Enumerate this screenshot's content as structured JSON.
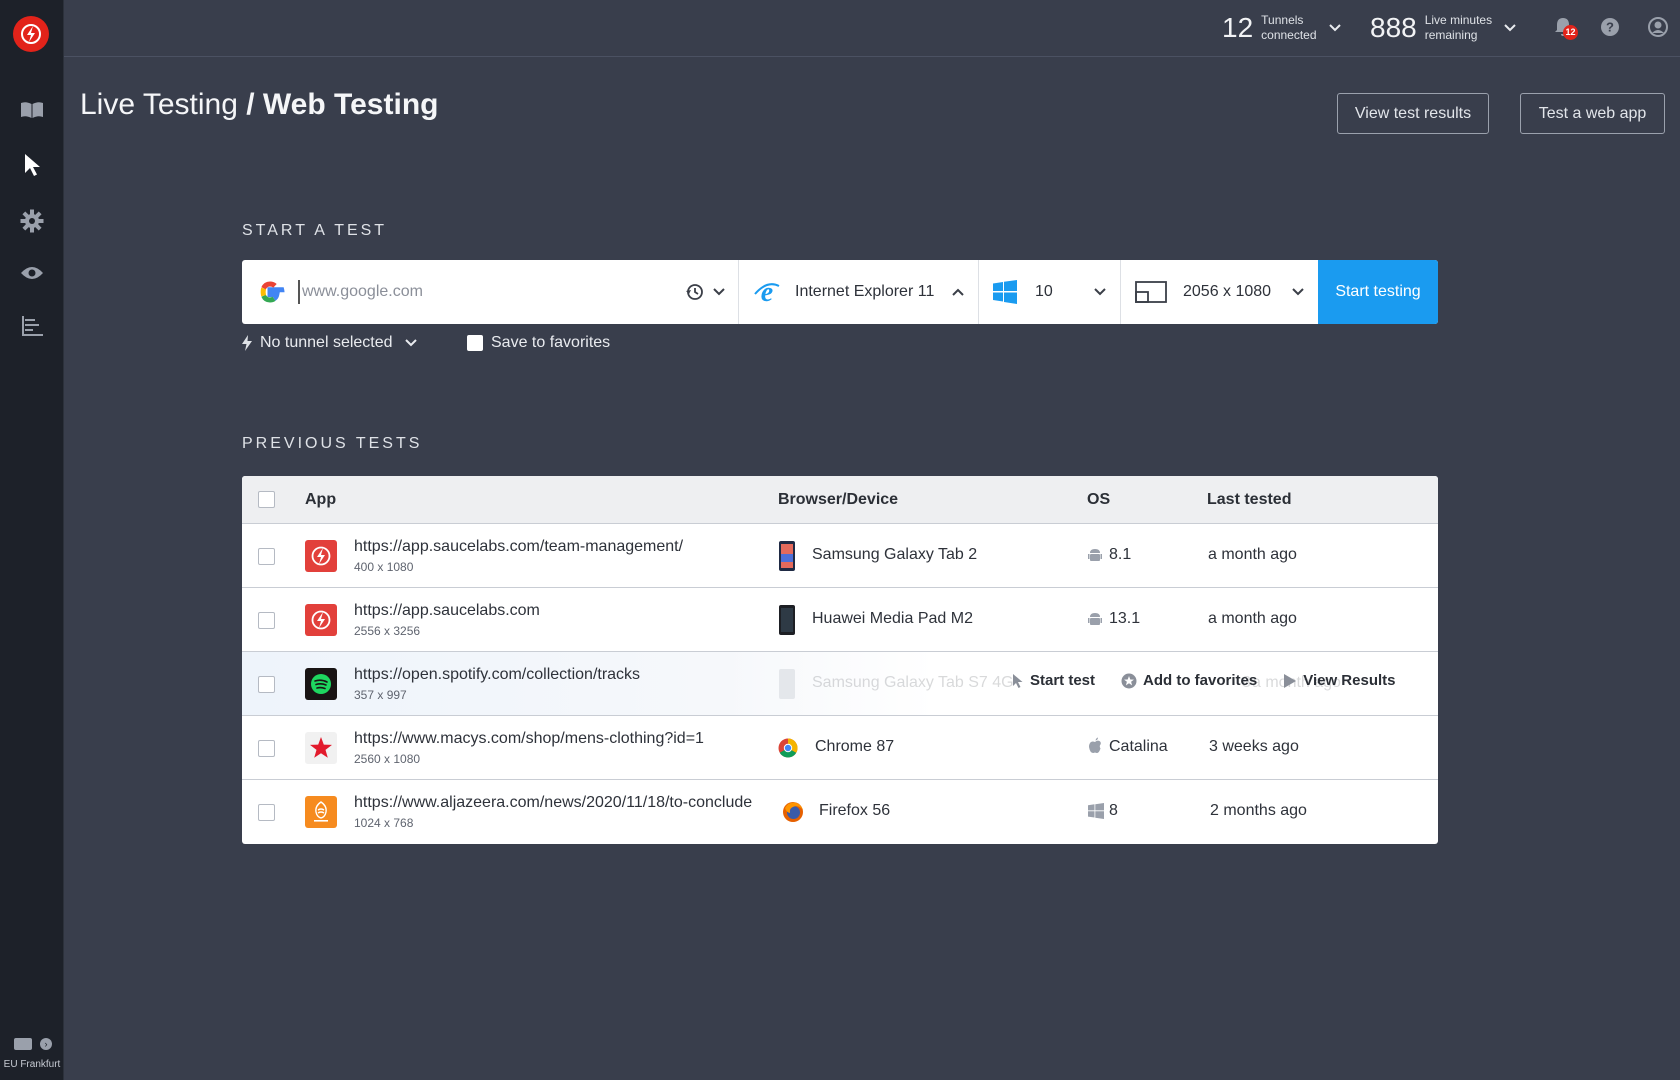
{
  "topbar": {
    "tunnels_count": "12",
    "tunnels_label_1": "Tunnels",
    "tunnels_label_2": "connected",
    "minutes_count": "888",
    "minutes_label_1": "Live minutes",
    "minutes_label_2": "remaining",
    "notifications_count": "12"
  },
  "sidebar": {
    "region": "EU Frankfurt",
    "items": [
      "book-icon",
      "cursor-icon",
      "gear-icon",
      "eye-icon",
      "bar-chart-icon"
    ]
  },
  "header": {
    "breadcrumb_parent": "Live Testing",
    "breadcrumb_sep": " / ",
    "breadcrumb_current": "Web Testing",
    "view_results_label": "View test results",
    "test_web_app_label": "Test a web app"
  },
  "start": {
    "section_label": "START A TEST",
    "url_placeholder": "www.google.com",
    "browser": "Internet Explorer 11",
    "os_version": "10",
    "resolution": "2056 x 1080",
    "start_label": "Start testing",
    "tunnel_label": "No tunnel selected",
    "save_favorites_label": "Save to favorites"
  },
  "previous": {
    "section_label": "PREVIOUS TESTS",
    "columns": {
      "app": "App",
      "browser": "Browser/Device",
      "os": "OS",
      "last": "Last tested"
    },
    "rows": [
      {
        "url": "https://app.saucelabs.com/team-management/",
        "res": "400 x 1080",
        "device": "Samsung Galaxy Tab 2",
        "os": "8.1",
        "last": "a month ago"
      },
      {
        "url": "https://app.saucelabs.com",
        "res": "2556 x 3256",
        "device": "Huawei Media Pad M2",
        "os": "13.1",
        "last": "a month ago"
      },
      {
        "url": "https://open.spotify.com/collection/tracks",
        "res": "357 x 997",
        "device": "Samsung Galaxy Tab S7 4G",
        "os": "8",
        "last": "a month ago"
      },
      {
        "url": "https://www.macys.com/shop/mens-clothing?id=1",
        "res": "2560 x 1080",
        "device": "Chrome 87",
        "os": "Catalina",
        "last": "3 weeks ago"
      },
      {
        "url": "https://www.aljazeera.com/news/2020/11/18/to-conclude",
        "res": "1024 x 768",
        "device": "Firefox 56",
        "os": "8",
        "last": "2 months ago"
      }
    ],
    "row_actions": {
      "start": "Start test",
      "favorite": "Add to favorites",
      "results": "View Results"
    }
  },
  "colors": {
    "accent": "#1a9bf0",
    "brand": "#e2231a",
    "background": "#393e4c",
    "sidebar": "#1d2129"
  }
}
